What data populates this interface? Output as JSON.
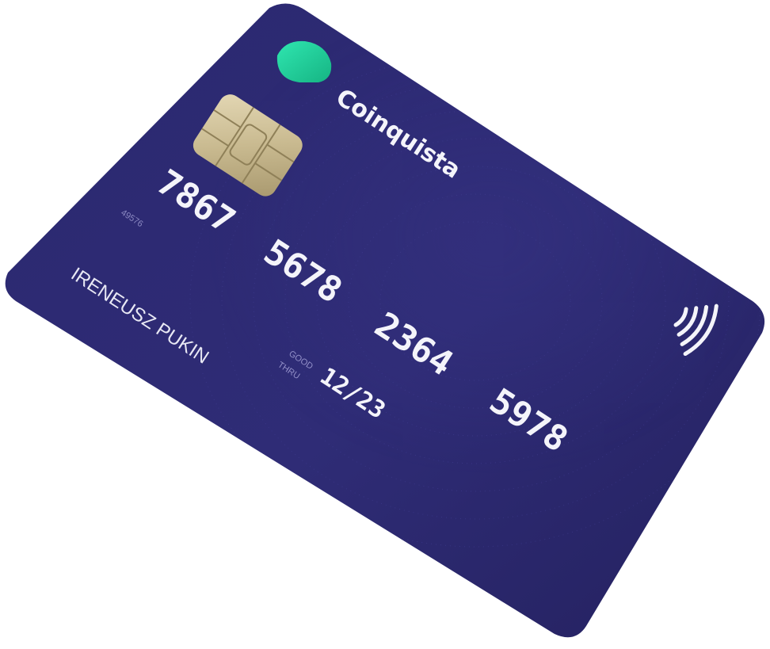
{
  "brand": {
    "name": "Coinquista",
    "logo_icon": "speech-bubble-icon"
  },
  "card": {
    "number_groups": [
      "7867",
      "5678",
      "2364",
      "5978"
    ],
    "small_code": "49576",
    "cardholder_name": "IRENEUSZ PUKIN",
    "expiry_label_top": "GOOD",
    "expiry_label_bottom": "THRU",
    "expiry": "12/23",
    "contactless_icon": "contactless-icon",
    "chip_icon": "emv-chip-icon"
  },
  "colors": {
    "card_base": "#2e2b73",
    "card_dark": "#242165",
    "logo_teal": "#2fe0a8",
    "logo_green": "#1fbf8a",
    "chip_gold": "#cdbf98",
    "text_white": "#f4f4fa"
  }
}
